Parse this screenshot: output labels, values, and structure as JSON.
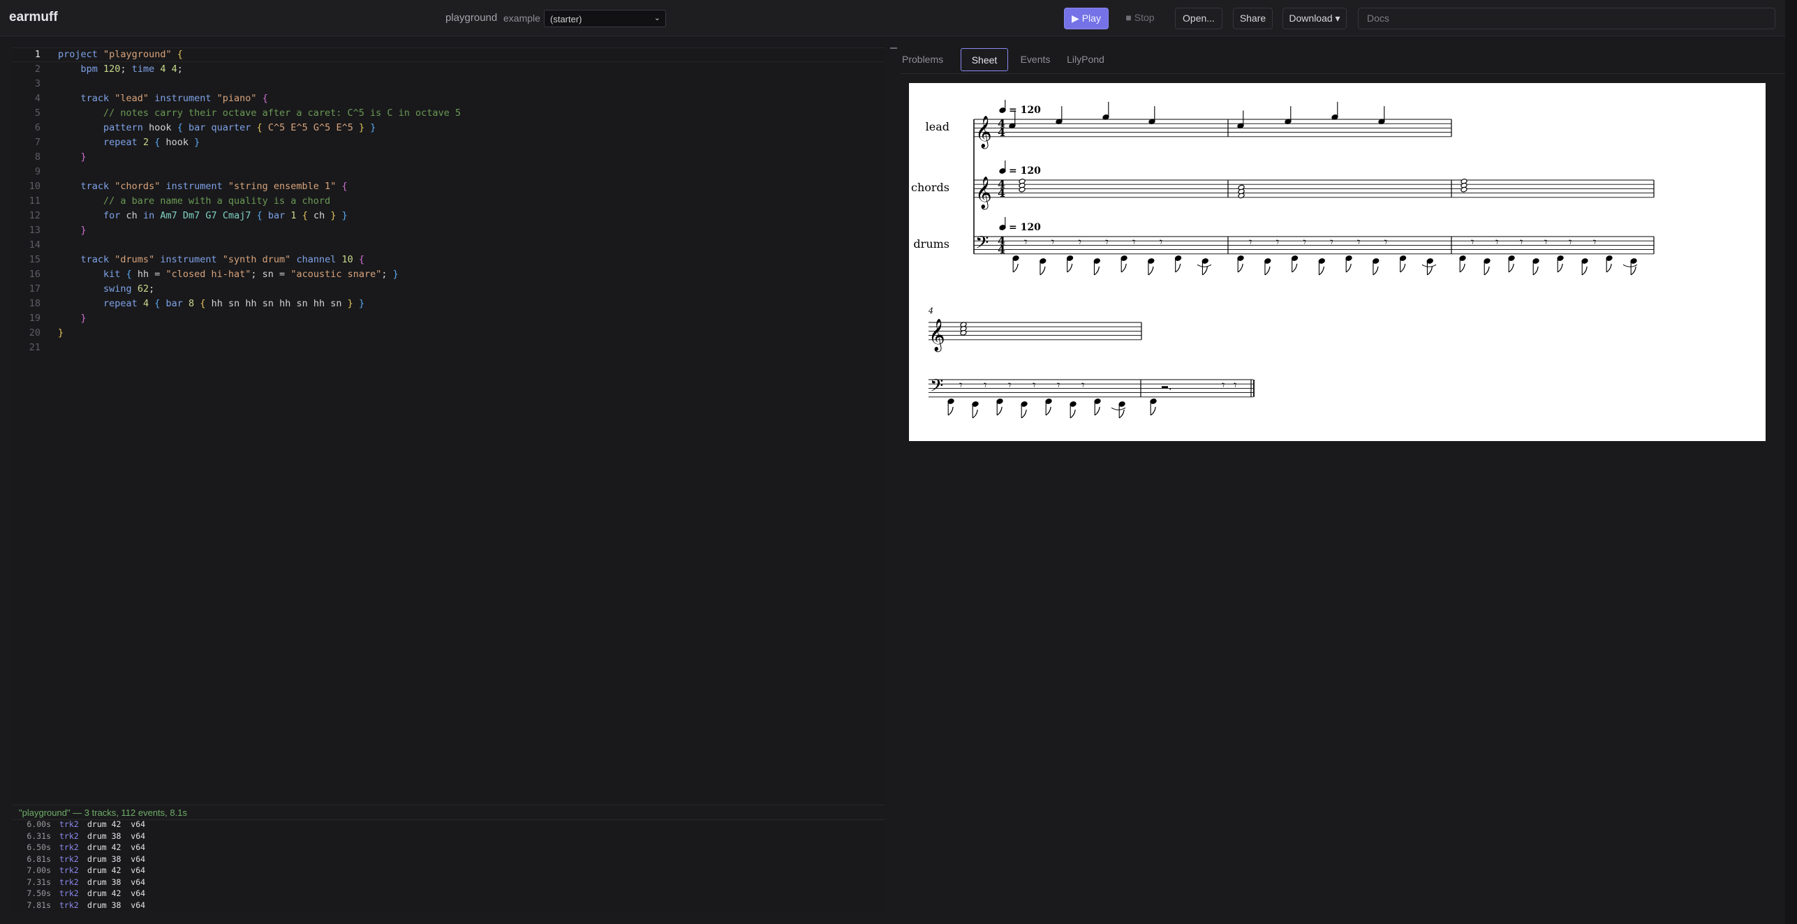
{
  "app": {
    "name": "earmuff"
  },
  "header": {
    "project_label": "playground",
    "example_label": "example",
    "example_value": "(starter)",
    "buttons": {
      "play": "▶ Play",
      "stop": "■ Stop",
      "open": "Open...",
      "share": "Share",
      "download": "Download ▾"
    },
    "docs_placeholder": "Docs"
  },
  "editor": {
    "line_numbers": [
      "1",
      "2",
      "3",
      "4",
      "5",
      "6",
      "7",
      "8",
      "9",
      "10",
      "11",
      "12",
      "13",
      "14",
      "15",
      "16",
      "17",
      "18",
      "19",
      "20",
      "21"
    ],
    "lines": [
      "project \"playground\" {",
      "    bpm 120; time 4 4;",
      "",
      "    track \"lead\" instrument \"piano\" {",
      "        // notes carry their octave after a caret: C^5 is C in octave 5",
      "        pattern hook { bar quarter { C^5 E^5 G^5 E^5 } }",
      "        repeat 2 { hook }",
      "    }",
      "",
      "    track \"chords\" instrument \"string ensemble 1\" {",
      "        // a bare name with a quality is a chord",
      "        for ch in Am7 Dm7 G7 Cmaj7 { bar 1 { ch } }",
      "    }",
      "",
      "    track \"drums\" instrument \"synth drum\" channel 10 {",
      "        kit { hh = \"closed hi-hat\"; sn = \"acoustic snare\"; }",
      "        swing 62;",
      "        repeat 4 { bar 8 { hh sn hh sn hh sn hh sn } }",
      "    }",
      "}",
      ""
    ]
  },
  "status": {
    "text": "\"playground\" — 3 tracks, 112 events, 8.1s"
  },
  "log": {
    "rows": [
      {
        "time": "6.00s",
        "track": "trk2",
        "msg": "drum 42  v64"
      },
      {
        "time": "6.31s",
        "track": "trk2",
        "msg": "drum 38  v64"
      },
      {
        "time": "6.50s",
        "track": "trk2",
        "msg": "drum 42  v64"
      },
      {
        "time": "6.81s",
        "track": "trk2",
        "msg": "drum 38  v64"
      },
      {
        "time": "7.00s",
        "track": "trk2",
        "msg": "drum 42  v64"
      },
      {
        "time": "7.31s",
        "track": "trk2",
        "msg": "drum 38  v64"
      },
      {
        "time": "7.50s",
        "track": "trk2",
        "msg": "drum 42  v64"
      },
      {
        "time": "7.81s",
        "track": "trk2",
        "msg": "drum 38  v64"
      }
    ]
  },
  "tabs": [
    "Problems",
    "Sheet",
    "Events",
    "LilyPond"
  ],
  "active_tab": "Sheet",
  "score": {
    "tempo": "= 120",
    "staff_names": [
      "lead",
      "chords",
      "drums"
    ],
    "time_signature": "4/4",
    "system2_bar_number": "4"
  },
  "colors": {
    "accent": "#7472e6",
    "background": "#1a1a1c",
    "comment": "#6a9a55",
    "string": "#d8a37b",
    "keyword": "#7fa2e8"
  }
}
